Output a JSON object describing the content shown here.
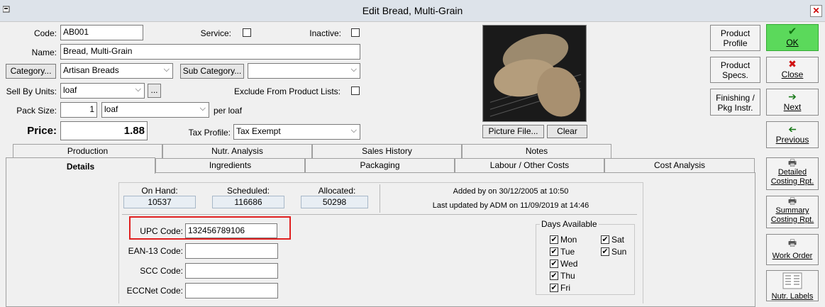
{
  "window": {
    "title": "Edit Bread, Multi-Grain",
    "close": "✕"
  },
  "form": {
    "code_label": "Code:",
    "code_value": "AB001",
    "service_label": "Service:",
    "inactive_label": "Inactive:",
    "name_label": "Name:",
    "name_value": "Bread, Multi-Grain",
    "category_button": "Category...",
    "category_value": "Artisan Breads",
    "subcategory_button": "Sub Category...",
    "subcategory_value": "",
    "sell_by_label": "Sell By Units:",
    "sell_by_value": "loaf",
    "ellipsis": "...",
    "exclude_label": "Exclude From Product Lists:",
    "pack_size_label": "Pack Size:",
    "pack_size_value": "1",
    "pack_unit_value": "loaf",
    "per_label": "per loaf",
    "price_label": "Price:",
    "price_value": "1.88",
    "tax_label": "Tax Profile:",
    "tax_value": "Tax Exempt"
  },
  "picture": {
    "file_button": "Picture File...",
    "clear_button": "Clear"
  },
  "right_buttons": {
    "product_profile": "Product\nProfile",
    "product_specs": "Product\nSpecs.",
    "finishing": "Finishing /\nPkg Instr.",
    "ok": "OK",
    "close": "Close",
    "next": "Next",
    "previous": "Previous",
    "detailed": "Detailed\nCosting Rpt.",
    "summary": "Summary\nCosting Rpt.",
    "work_order": "Work Order",
    "nutr_labels": "Nutr. Labels"
  },
  "tabs_top": [
    "Production",
    "Nutr. Analysis",
    "Sales History",
    "Notes"
  ],
  "tabs_bottom": [
    "Details",
    "Ingredients",
    "Packaging",
    "Labour / Other Costs",
    "Cost Analysis"
  ],
  "details": {
    "on_hand_label": "On Hand:",
    "on_hand_value": "10537",
    "scheduled_label": "Scheduled:",
    "scheduled_value": "116686",
    "allocated_label": "Allocated:",
    "allocated_value": "50298",
    "added_by": "Added by  on 30/12/2005 at 10:50",
    "last_updated": "Last updated by ADM on 11/09/2019 at 14:46",
    "upc_label": "UPC Code:",
    "upc_value": "132456789106",
    "ean_label": "EAN-13 Code:",
    "ean_value": "",
    "scc_label": "SCC Code:",
    "scc_value": "",
    "eccnet_label": "ECCNet Code:",
    "eccnet_value": "",
    "days_title": "Days Available",
    "days": [
      "Mon",
      "Sat",
      "Tue",
      "Sun",
      "Wed",
      "Thu",
      "Fri"
    ]
  },
  "colors": {
    "ok_green": "#5bd95b",
    "highlight_red": "#e02020",
    "title_bar": "#dde3ea"
  }
}
